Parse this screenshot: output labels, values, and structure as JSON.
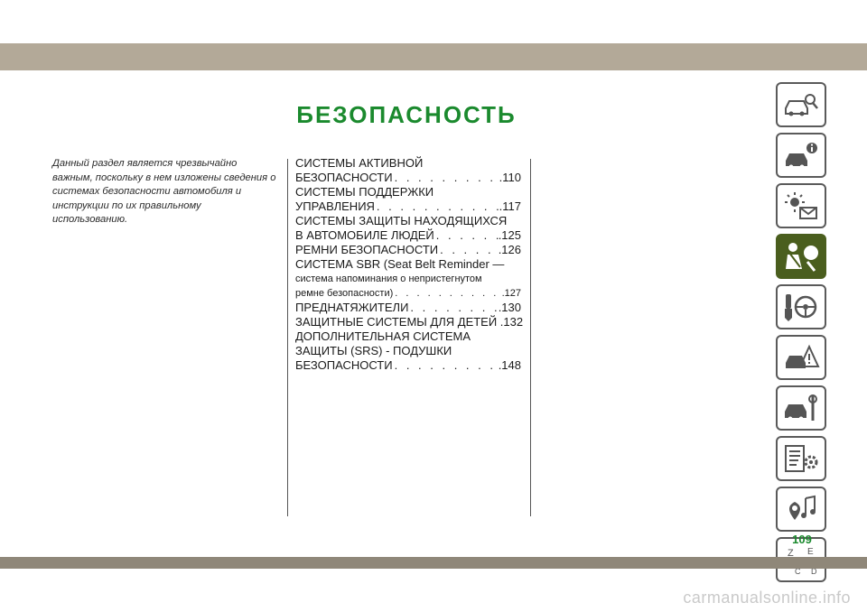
{
  "title": "БЕЗОПАСНОСТЬ",
  "intro": "Данный раздел является чрезвычайно важным, поскольку в нем изложены сведения о системах безопасности автомобиля и инструкции по их правильному использованию.",
  "toc": [
    {
      "text": "СИСТЕМЫ АКТИВНОЙ"
    },
    {
      "text": "БЕЗОПАСНОСТИ",
      "page": ".110"
    },
    {
      "text": "СИСТЕМЫ ПОДДЕРЖКИ"
    },
    {
      "text": "УПРАВЛЕНИЯ",
      "page": ".117"
    },
    {
      "text": "СИСТЕМЫ ЗАЩИТЫ НАХОДЯЩИХСЯ"
    },
    {
      "text": "В АВТОМОБИЛЕ ЛЮДЕЙ",
      "page": ".125"
    },
    {
      "text": "РЕМНИ БЕЗОПАСНОСТИ",
      "page": ".126"
    },
    {
      "text": "СИСТЕМА SBR (Seat Belt Reminder —"
    },
    {
      "text": "система напоминания о непристегнутом",
      "small": true
    },
    {
      "text": "ремне безопасности)",
      "page": ".127",
      "small": true
    },
    {
      "text": "ПРЕДНАТЯЖИТЕЛИ",
      "page": ".130"
    },
    {
      "text": "ЗАЩИТНЫЕ СИСТЕМЫ ДЛЯ ДЕТЕЙ .132"
    },
    {
      "text": "ДОПОЛНИТЕЛЬНАЯ СИСТЕМА"
    },
    {
      "text": "ЗАЩИТЫ (SRS) - ПОДУШКИ"
    },
    {
      "text": "БЕЗОПАСНОСТИ",
      "page": ".148"
    }
  ],
  "tabs": [
    {
      "icon": "car-search-icon",
      "active": false
    },
    {
      "icon": "car-info-icon",
      "active": false
    },
    {
      "icon": "warning-lights-icon",
      "active": false
    },
    {
      "icon": "safety-airbag-icon",
      "active": true
    },
    {
      "icon": "key-steering-wheel-icon",
      "active": false
    },
    {
      "icon": "car-breakdown-icon",
      "active": false
    },
    {
      "icon": "car-tools-icon",
      "active": false
    },
    {
      "icon": "specs-gear-icon",
      "active": false
    },
    {
      "icon": "multimedia-navigation-icon",
      "active": false
    },
    {
      "icon": "index-letters-icon",
      "active": false
    }
  ],
  "page_number": "109",
  "watermark": "carmanualsonline.info",
  "colors": {
    "accent": "#1b8a2e",
    "active_tab": "#4a5e1e",
    "band": "#b3a998"
  }
}
